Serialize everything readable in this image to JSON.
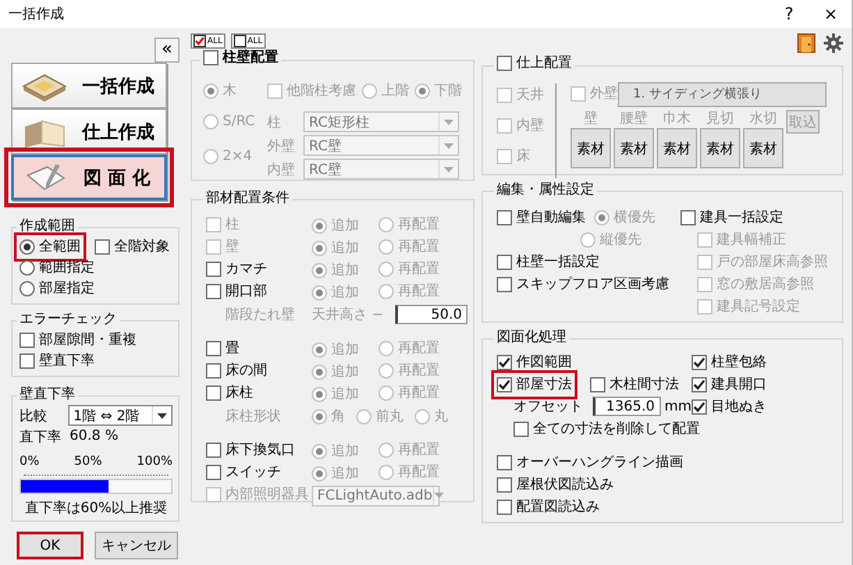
{
  "window": {
    "title": "一括作成",
    "buttons": [
      "?",
      "×"
    ]
  },
  "sidebar": {
    "collapse": "«",
    "modes": [
      {
        "label": "一括作成",
        "selected": false,
        "highlighted": false
      },
      {
        "label": "仕上作成",
        "selected": false,
        "highlighted": false
      },
      {
        "label": "図 面 化",
        "selected": true,
        "highlighted": true
      }
    ],
    "range": {
      "title": "作成範囲",
      "options": [
        {
          "label": "全範囲",
          "selected": true,
          "highlighted": true
        },
        {
          "label": "範囲指定",
          "selected": false,
          "highlighted": false
        },
        {
          "label": "部屋指定",
          "selected": false,
          "highlighted": false
        }
      ],
      "all_floors": {
        "label": "全階対象",
        "checked": false
      }
    },
    "error_check": {
      "title": "エラーチェック",
      "items": [
        {
          "label": "部屋隙間・重複",
          "checked": false
        },
        {
          "label": "壁直下率",
          "checked": false
        }
      ]
    },
    "wall_ratio": {
      "title": "壁直下率",
      "compare_label": "比較",
      "compare_value": "1階 ⇔ 2階",
      "rate_label": "直下率",
      "rate_value": "60.8 %",
      "scale": [
        "0%",
        "50%",
        "100%"
      ],
      "level": 0.58,
      "note": "直下率は60%以上推奨"
    },
    "buttons": [
      {
        "label": "OK",
        "highlighted": true
      },
      {
        "label": "キャンセル",
        "highlighted": false
      }
    ]
  },
  "check_all": [
    {
      "label": "ALL",
      "checked": true
    },
    {
      "label": "ALL",
      "checked": false
    }
  ],
  "pillar_wall": {
    "title": "柱壁配置",
    "checked": false,
    "structures": [
      {
        "label": "木",
        "selected": true
      },
      {
        "label": "S/RC",
        "selected": false
      },
      {
        "label": "2×4",
        "selected": false
      }
    ],
    "other_floor": {
      "label": "他階柱考慮",
      "checked": false
    },
    "floors": [
      {
        "label": "上階",
        "selected": false
      },
      {
        "label": "下階",
        "selected": true
      }
    ],
    "selects": [
      {
        "label": "柱",
        "value": "RC矩形柱"
      },
      {
        "label": "外壁",
        "value": "RC壁"
      },
      {
        "label": "内壁",
        "value": "RC壁"
      }
    ]
  },
  "members": {
    "title": "部材配置条件",
    "groups": [
      [
        {
          "kind": "check",
          "label": "柱",
          "checked": false,
          "disabled": true,
          "options": [
            {
              "label": "追加",
              "selected": true
            },
            {
              "label": "再配置",
              "selected": false
            }
          ]
        },
        {
          "kind": "check",
          "label": "壁",
          "checked": false,
          "disabled": true,
          "options": [
            {
              "label": "追加",
              "selected": true
            },
            {
              "label": "再配置",
              "selected": false
            }
          ]
        },
        {
          "kind": "check",
          "label": "カマチ",
          "checked": false,
          "disabled": false,
          "options": [
            {
              "label": "追加",
              "selected": true
            },
            {
              "label": "再配置",
              "selected": false
            }
          ]
        },
        {
          "kind": "check",
          "label": "開口部",
          "checked": false,
          "disabled": false,
          "options": [
            {
              "label": "追加",
              "selected": true
            },
            {
              "label": "再配置",
              "selected": false
            }
          ]
        },
        {
          "kind": "height",
          "label": "階段たれ壁",
          "field_label": "天井高さ −",
          "value": "50.0",
          "disabled": true
        }
      ],
      [
        {
          "kind": "check",
          "label": "畳",
          "checked": false,
          "disabled": false,
          "options": [
            {
              "label": "追加",
              "selected": true
            },
            {
              "label": "再配置",
              "selected": false
            }
          ]
        },
        {
          "kind": "check",
          "label": "床の間",
          "checked": false,
          "disabled": false,
          "options": [
            {
              "label": "追加",
              "selected": true
            },
            {
              "label": "再配置",
              "selected": false
            }
          ]
        },
        {
          "kind": "check",
          "label": "床柱",
          "checked": false,
          "disabled": false,
          "options": [
            {
              "label": "追加",
              "selected": true
            },
            {
              "label": "再配置",
              "selected": false
            }
          ]
        },
        {
          "kind": "shape",
          "label": "床柱形状",
          "disabled": true,
          "options": [
            {
              "label": "角",
              "selected": true
            },
            {
              "label": "前丸",
              "selected": false
            },
            {
              "label": "丸",
              "selected": false
            }
          ]
        }
      ],
      [
        {
          "kind": "check",
          "label": "床下換気口",
          "checked": false,
          "disabled": false,
          "options": [
            {
              "label": "追加",
              "selected": true
            },
            {
              "label": "再配置",
              "selected": false
            }
          ]
        },
        {
          "kind": "check",
          "label": "スイッチ",
          "checked": false,
          "disabled": false,
          "options": [
            {
              "label": "追加",
              "selected": true
            },
            {
              "label": "再配置",
              "selected": false
            }
          ]
        },
        {
          "kind": "file",
          "label": "内部照明器具",
          "checked": false,
          "disabled": true,
          "value": "FCLightAuto.adb"
        }
      ]
    ]
  },
  "finish": {
    "title": "仕上配置",
    "checked": false,
    "areas": [
      {
        "label": "天井",
        "checked": false
      },
      {
        "label": "内壁",
        "checked": false
      },
      {
        "label": "床",
        "checked": false
      }
    ],
    "exterior": {
      "label": "外壁",
      "checked": false,
      "value": "1. サイディング横張り"
    },
    "materials": [
      {
        "label": "壁",
        "button": "素材"
      },
      {
        "label": "腰壁",
        "button": "素材"
      },
      {
        "label": "巾木",
        "button": "素材"
      },
      {
        "label": "見切",
        "button": "素材"
      },
      {
        "label": "水切",
        "button": "素材"
      }
    ],
    "import": "取込"
  },
  "edit": {
    "title": "編集・属性設定",
    "auto_edit": {
      "label": "壁自動編集",
      "checked": false,
      "options": [
        {
          "label": "横優先",
          "selected": true
        },
        {
          "label": "縦優先",
          "selected": false
        }
      ]
    },
    "items": [
      {
        "label": "柱壁一括設定",
        "checked": false
      },
      {
        "label": "スキップフロア区画考慮",
        "checked": false
      }
    ],
    "fittings": {
      "label": "建具一括設定",
      "checked": false,
      "children": [
        {
          "label": "建具幅補正",
          "checked": false
        },
        {
          "label": "戸の部屋床高参照",
          "checked": false
        },
        {
          "label": "窓の敷居高参照",
          "checked": false
        },
        {
          "label": "建具記号設定",
          "checked": false
        }
      ]
    }
  },
  "drawing": {
    "title": "図面化処理",
    "range": {
      "label": "作図範囲",
      "checked": true
    },
    "room_dims": {
      "label": "部屋寸法",
      "checked": true,
      "highlighted": true
    },
    "pillar_dims": {
      "label": "木柱間寸法",
      "checked": false
    },
    "offset": {
      "label": "オフセット",
      "value": "1365.0",
      "unit": "mm"
    },
    "delete_all": {
      "label": "全ての寸法を削除して配置",
      "checked": false
    },
    "right": [
      {
        "label": "柱壁包絡",
        "checked": true
      },
      {
        "label": "建具開口",
        "checked": true
      },
      {
        "label": "目地ぬき",
        "checked": true
      }
    ],
    "imports": [
      {
        "label": "オーバーハングライン描画",
        "checked": false
      },
      {
        "label": "屋根伏図読込み",
        "checked": false
      },
      {
        "label": "配置図読込み",
        "checked": false
      }
    ]
  }
}
